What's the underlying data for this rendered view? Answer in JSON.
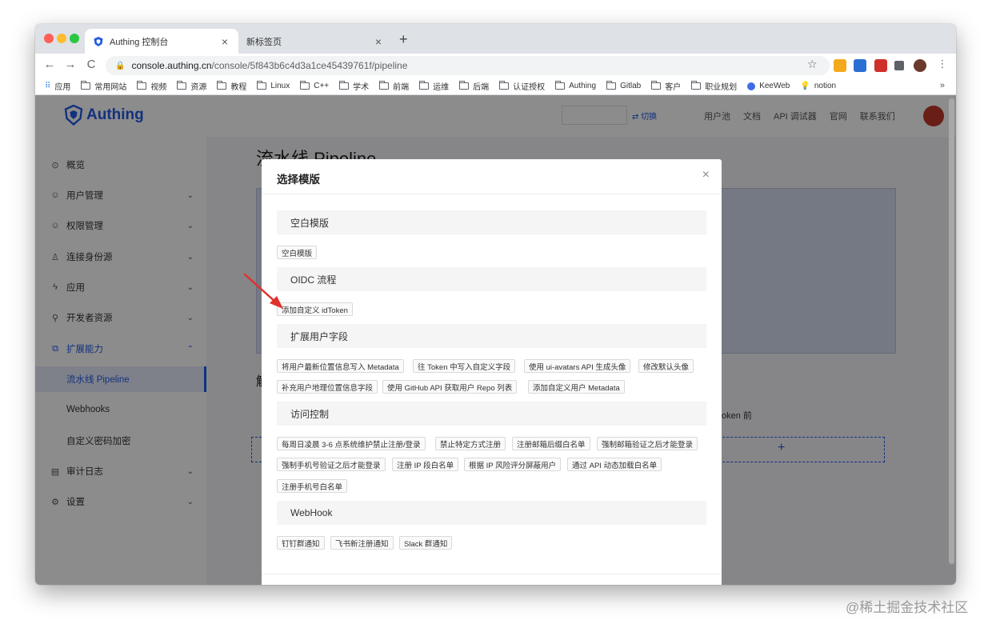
{
  "browser": {
    "tabs": [
      {
        "title": "Authing 控制台",
        "close": "×"
      },
      {
        "title": "新标签页",
        "close": "×"
      }
    ],
    "new_tab": "+",
    "nav": {
      "back": "←",
      "forward": "→",
      "reload": "C"
    },
    "url_host": "console.authing.cn",
    "url_path": "/console/5f843b6c4d3a1ce45439761f/pipeline",
    "star": "☆",
    "bookmarks": [
      "应用",
      "常用网站",
      "视频",
      "资源",
      "教程",
      "Linux",
      "C++",
      "学术",
      "前端",
      "运维",
      "后端",
      "认证授权",
      "Authing",
      "Gitlab",
      "客户",
      "职业规划",
      "KeeWeb",
      "notion"
    ],
    "bookmarks_more": "»"
  },
  "app": {
    "logo_text": "Authing",
    "switch_label": "⇄ 切换",
    "top_links": [
      "用户池",
      "文档",
      "API 调试器",
      "官网",
      "联系我们"
    ]
  },
  "sidebar": {
    "items": [
      {
        "label": "概览",
        "icon": "⊙"
      },
      {
        "label": "用户管理",
        "icon": "☺",
        "chevron": "⌄"
      },
      {
        "label": "权限管理",
        "icon": "☺",
        "chevron": "⌄"
      },
      {
        "label": "连接身份源",
        "icon": "♙",
        "chevron": "⌄"
      },
      {
        "label": "应用",
        "icon": "ϟ",
        "chevron": "⌄"
      },
      {
        "label": "开发者资源",
        "icon": "⚲",
        "chevron": "⌄"
      },
      {
        "label": "扩展能力",
        "icon": "⧉",
        "chevron": "⌃"
      },
      {
        "label": "审计日志",
        "icon": "▤",
        "chevron": "⌄"
      },
      {
        "label": "设置",
        "icon": "⚙",
        "chevron": "⌄"
      }
    ],
    "sub_items": [
      "流水线 Pipeline",
      "Webhooks",
      "自定义密码加密"
    ]
  },
  "main": {
    "title": "流水线 Pipeline",
    "sub_heading": "触",
    "before_text": "oken 前",
    "add_plus": "+"
  },
  "modal": {
    "title": "选择模版",
    "close": "×",
    "sections": [
      {
        "title": "空白模版",
        "templates": [
          "空白模版"
        ]
      },
      {
        "title": "OIDC 流程",
        "templates": [
          "添加自定义 idToken"
        ]
      },
      {
        "title": "扩展用户字段",
        "templates": [
          "将用户最新位置信息写入 Metadata",
          "往 Token 中写入自定义字段",
          "使用 ui-avatars API 生成头像",
          "修改默认头像",
          "补充用户地理位置信息字段",
          "使用 GitHub API 获取用户 Repo 列表",
          "添加自定义用户 Metadata"
        ]
      },
      {
        "title": "访问控制",
        "templates": [
          "每周日凌晨 3-6 点系统维护禁止注册/登录",
          "禁止特定方式注册",
          "注册邮箱后缀白名单",
          "强制邮箱验证之后才能登录",
          "强制手机号验证之后才能登录",
          "注册 IP 段白名单",
          "根据 IP 风险评分屏蔽用户",
          "通过 API 动态加载白名单",
          "注册手机号白名单"
        ]
      },
      {
        "title": "WebHook",
        "templates": [
          "钉钉群通知",
          "飞书新注册通知",
          "Slack 群通知"
        ]
      }
    ]
  },
  "watermark": "@稀土掘金技术社区",
  "colors": {
    "brand": "#215ae5",
    "arrow": "#e0312a"
  }
}
